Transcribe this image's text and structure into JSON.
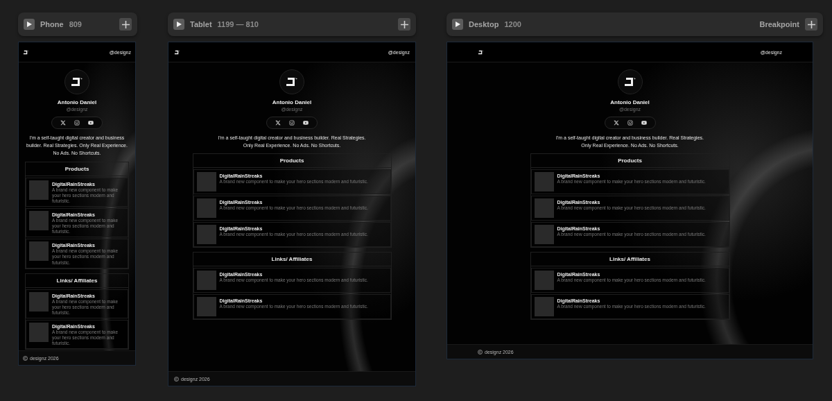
{
  "frames": [
    {
      "kind": "phone",
      "name": "Phone",
      "size": "809",
      "site": {
        "handle": "@designz",
        "name": "Antonio Daniel",
        "username": "@designz",
        "bio": "I'm a self-taught digital creator and business builder. Real Strategies. Only Real Experience. No Ads. No Shortcuts.",
        "sections": [
          {
            "title": "Products",
            "items": [
              {
                "title": "DigitalRainStreaks",
                "description": "A brand new component to make your hero sections modern and futuristic."
              },
              {
                "title": "DigitalRainStreaks",
                "description": "A brand new component to make your hero sections modern and futuristic."
              },
              {
                "title": "DigitalRainStreaks",
                "description": "A brand new component to make your hero sections modern and futuristic."
              }
            ]
          },
          {
            "title": "Links/ Affiliates",
            "items": [
              {
                "title": "DigitalRainStreaks",
                "description": "A brand new component to make your hero sections modern and futuristic."
              },
              {
                "title": "DigitalRainStreaks",
                "description": "A brand new component to make your hero sections modern and futuristic."
              }
            ]
          }
        ],
        "footer": "designz 2026"
      }
    },
    {
      "kind": "tablet",
      "name": "Tablet",
      "size": "1199 — 810",
      "site": {
        "handle": "@designz",
        "name": "Antonio Daniel",
        "username": "@designz",
        "bio": "I'm a self-taught digital creator and business builder. Real Strategies. Only Real Experience. No Ads. No Shortcuts.",
        "sections": [
          {
            "title": "Products",
            "items": [
              {
                "title": "DigitalRainStreaks",
                "description": "A brand new component to make your hero sections modern and futuristic."
              },
              {
                "title": "DigitalRainStreaks",
                "description": "A brand new component to make your hero sections modern and futuristic."
              },
              {
                "title": "DigitalRainStreaks",
                "description": "A brand new component to make your hero sections modern and futuristic."
              }
            ]
          },
          {
            "title": "Links/ Affiliates",
            "items": [
              {
                "title": "DigitalRainStreaks",
                "description": "A brand new component to make your hero sections modern and futuristic."
              },
              {
                "title": "DigitalRainStreaks",
                "description": "A brand new component to make your hero sections modern and futuristic."
              }
            ]
          }
        ],
        "footer": "designz 2026"
      }
    },
    {
      "kind": "desktop",
      "name": "Desktop",
      "size": "1200",
      "action": "Breakpoint",
      "site": {
        "handle": "@designz",
        "name": "Antonio Daniel",
        "username": "@designz",
        "bio": "I'm a self-taught digital creator and business builder. Real Strategies. Only Real Experience. No Ads. No Shortcuts.",
        "sections": [
          {
            "title": "Products",
            "items": [
              {
                "title": "DigitalRainStreaks",
                "description": "A brand new component to make your hero sections modern and futuristic."
              },
              {
                "title": "DigitalRainStreaks",
                "description": "A brand new component to make your hero sections modern and futuristic."
              },
              {
                "title": "DigitalRainStreaks",
                "description": "A brand new component to make your hero sections modern and futuristic."
              }
            ]
          },
          {
            "title": "Links/ Affiliates",
            "items": [
              {
                "title": "DigitalRainStreaks",
                "description": "A brand new component to make your hero sections modern and futuristic."
              },
              {
                "title": "DigitalRainStreaks",
                "description": "A brand new component to make your hero sections modern and futuristic."
              }
            ]
          }
        ],
        "footer": "designz 2026"
      }
    }
  ]
}
